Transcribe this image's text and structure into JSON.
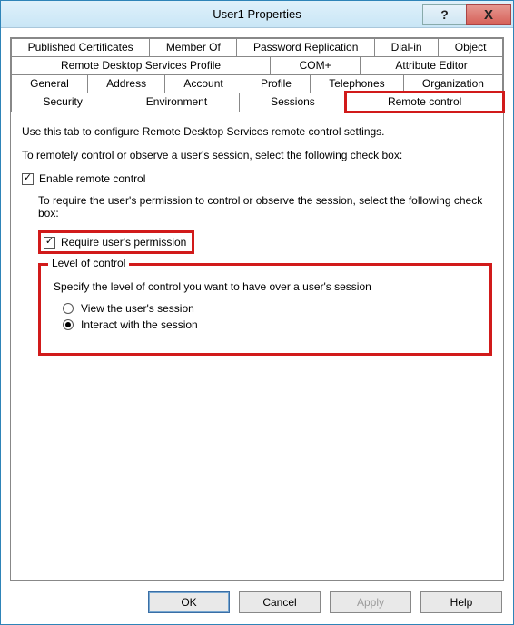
{
  "window": {
    "title": "User1 Properties",
    "help_glyph": "?",
    "close_glyph": "X"
  },
  "tabs": {
    "row1": [
      "Published Certificates",
      "Member Of",
      "Password Replication",
      "Dial-in",
      "Object"
    ],
    "row2": [
      "Remote Desktop Services Profile",
      "COM+",
      "Attribute Editor"
    ],
    "row3": [
      "General",
      "Address",
      "Account",
      "Profile",
      "Telephones",
      "Organization"
    ],
    "row4": [
      "Security",
      "Environment",
      "Sessions",
      "Remote control"
    ],
    "active": "Remote control"
  },
  "body": {
    "intro": "Use this tab to configure Remote Desktop Services remote control settings.",
    "enable_prompt": "To remotely control or observe a user's session, select the following check box:",
    "enable_label": "Enable remote control",
    "enable_checked": true,
    "permission_prompt": "To require the user's permission to control or observe the session, select the following check box:",
    "permission_label": "Require user's permission",
    "permission_checked": true,
    "level": {
      "legend": "Level of control",
      "specify": "Specify the level of control you want to have over a user's session",
      "view_label": "View the user's session",
      "interact_label": "Interact with the session",
      "selected": "interact"
    }
  },
  "buttons": {
    "ok": "OK",
    "cancel": "Cancel",
    "apply": "Apply",
    "help": "Help"
  }
}
